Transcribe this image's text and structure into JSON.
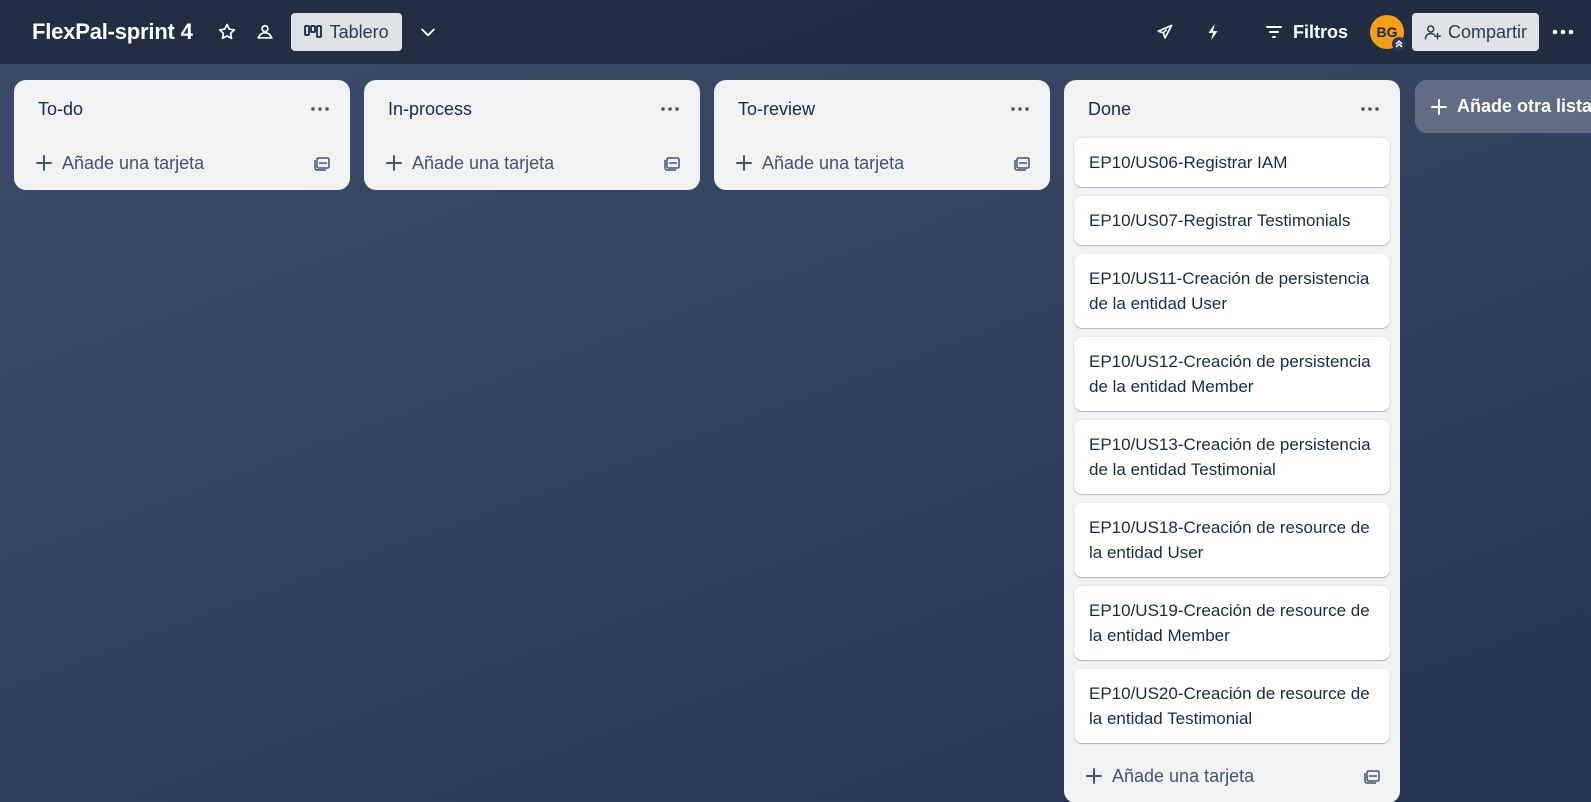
{
  "board": {
    "title": "FlexPal-sprint 4",
    "view_label": "Tablero",
    "filters_label": "Filtros",
    "avatar_initials": "BG",
    "share_label": "Compartir",
    "add_list_label": "Añade otra lista"
  },
  "lists": [
    {
      "title": "To-do",
      "add_card_label": "Añade una tarjeta"
    },
    {
      "title": "In-process",
      "add_card_label": "Añade una tarjeta"
    },
    {
      "title": "To-review",
      "add_card_label": "Añade una tarjeta"
    },
    {
      "title": "Done",
      "add_card_label": "Añade una tarjeta",
      "cards": [
        "EP10/US06-Registrar IAM",
        "EP10/US07-Registrar Testimonials",
        "EP10/US11-Creación de persistencia de la entidad User",
        "EP10/US12-Creación de persistencia de la entidad Member",
        "EP10/US13-Creación de persistencia de la entidad Testimonial",
        "EP10/US18-Creación de resource de la entidad User",
        "EP10/US19-Creación de resource de la entidad Member",
        "EP10/US20-Creación de resource de la entidad Testimonial"
      ]
    }
  ],
  "colors": {
    "header_bg": "#1e2638",
    "list_bg": "#f1f2f4",
    "avatar_bg": "#f59e1b",
    "text_primary": "#172b4d"
  },
  "icons": {
    "star": "star-icon",
    "visibility": "workspace-visibility-icon",
    "board_view": "board-view-icon",
    "chevron": "chevron-down-icon",
    "powerups": "rocket-icon",
    "automation": "lightning-icon",
    "filter": "filter-icon",
    "share": "add-person-icon",
    "more": "more-icon"
  }
}
